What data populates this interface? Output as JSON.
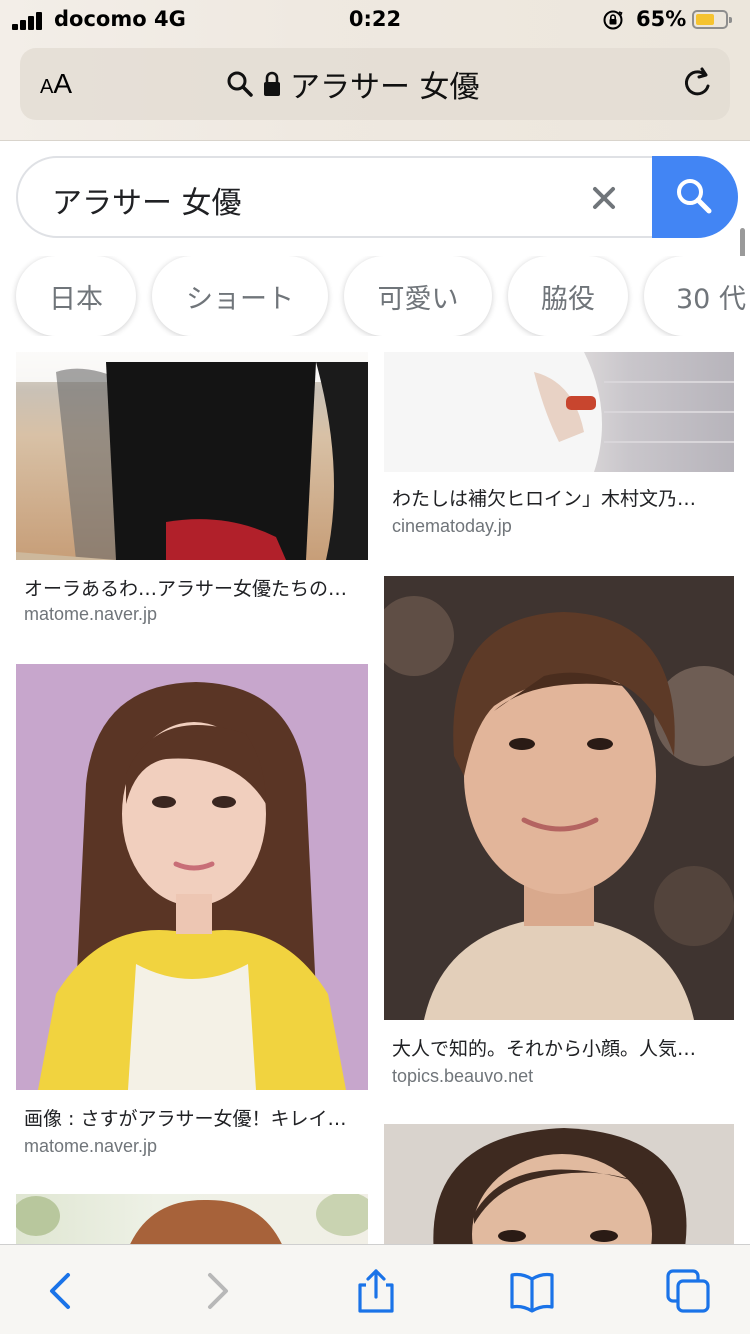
{
  "status_bar": {
    "carrier": "docomo 4G",
    "time": "0:22",
    "battery_percent": "65%",
    "battery_level": 0.65,
    "battery_color": "#f5c330"
  },
  "address_bar": {
    "text_size_label": "AA",
    "url_text": "アラサー 女優",
    "search_icon": "search-icon",
    "lock_icon": "lock-icon",
    "reload_icon": "reload-icon"
  },
  "search": {
    "query": "アラサー 女優",
    "clear_icon": "close-icon",
    "submit_icon": "search-icon",
    "accent_color": "#4285f4"
  },
  "chips": [
    "日本",
    "ショート",
    "可愛い",
    "脇役",
    "30 代"
  ],
  "results": [
    {
      "caption": "オーラあるわ…アラサー女優たちの…",
      "source": "matome.naver.jp"
    },
    {
      "caption": "わたしは補欠ヒロイン」木村文乃…",
      "source": "cinematoday.jp"
    },
    {
      "caption": "画像 : さすがアラサー女優！キレイ…",
      "source": "matome.naver.jp"
    },
    {
      "caption": "大人で知的。それから小顔。人気…",
      "source": "topics.beauvo.net"
    }
  ],
  "toolbar": {
    "back_icon": "back-arrow-icon",
    "forward_icon": "forward-arrow-icon",
    "share_icon": "share-icon",
    "bookmarks_icon": "bookmarks-icon",
    "tabs_icon": "tabs-icon",
    "active_color": "#1a73e8"
  }
}
